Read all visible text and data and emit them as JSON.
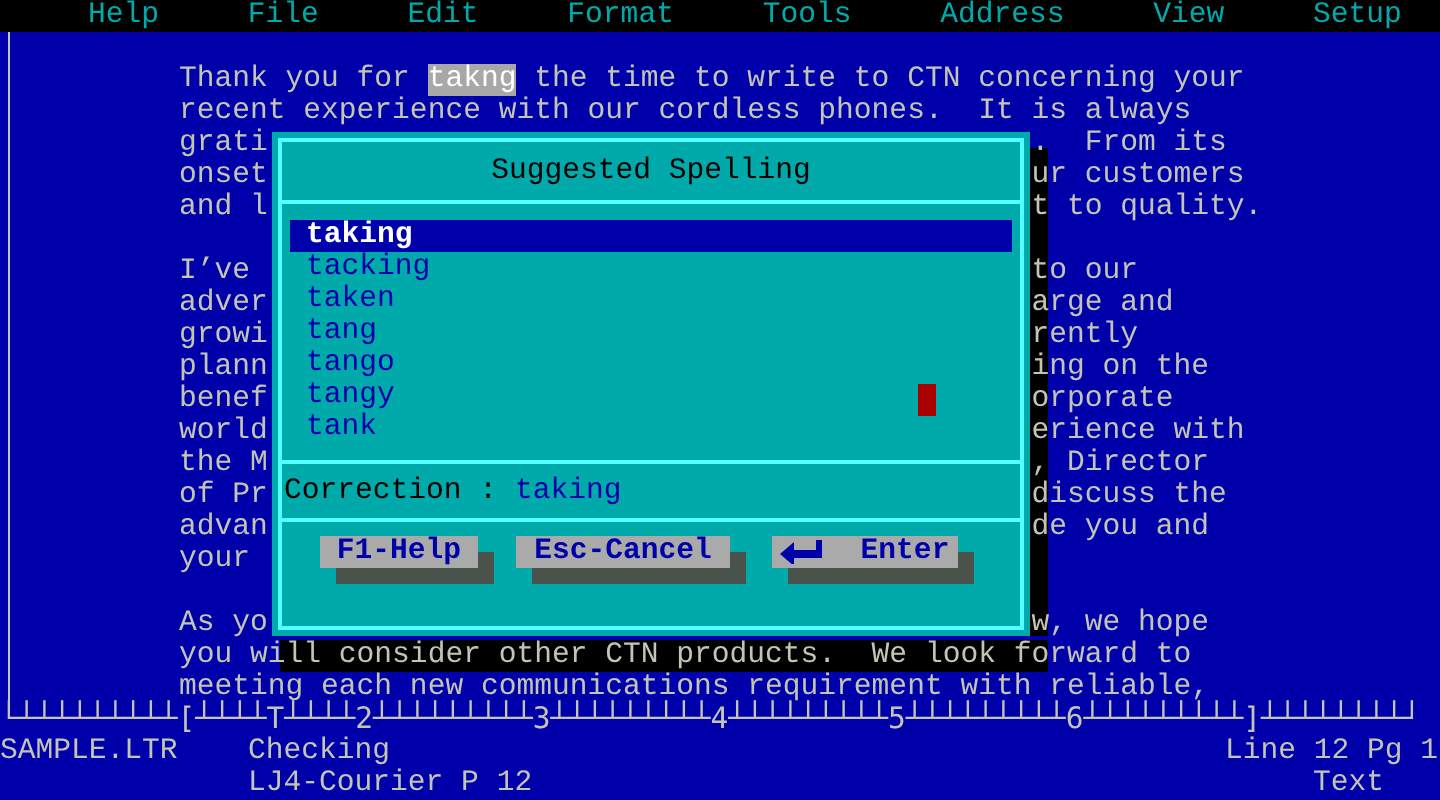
{
  "menu": [
    "Help",
    "File",
    "Edit",
    "Format",
    "Tools",
    "Address",
    "View",
    "Setup"
  ],
  "document": {
    "lines": [
      {
        "kind": "flagged",
        "before": "Thank you for",
        "flagged": "takng",
        "after": "the time to write to CTN concerning your"
      },
      {
        "kind": "full",
        "text": "recent experience with our cordless phones.  It is always"
      },
      {
        "kind": "split",
        "left": "grati",
        "right": ".  From its"
      },
      {
        "kind": "split",
        "left": "onset",
        "right": "ur customers"
      },
      {
        "kind": "split",
        "left": "and l",
        "right": "t to quality."
      },
      {
        "kind": "blank"
      },
      {
        "kind": "split",
        "left": "I’ve",
        "right": "to our"
      },
      {
        "kind": "split",
        "left": "adver",
        "right": "arge and"
      },
      {
        "kind": "split",
        "left": "growi",
        "right": "rently"
      },
      {
        "kind": "split",
        "left": "plann",
        "right": "ing on the"
      },
      {
        "kind": "split",
        "left": "benef",
        "right": "orporate"
      },
      {
        "kind": "split",
        "left": "world",
        "right": "erience with"
      },
      {
        "kind": "split",
        "left": "the M",
        "right": ", Director"
      },
      {
        "kind": "split",
        "left": "of Pr",
        "right": "discuss the"
      },
      {
        "kind": "split",
        "left": "advan",
        "right": "de you and"
      },
      {
        "kind": "split",
        "left": "your"
      },
      {
        "kind": "blank"
      },
      {
        "kind": "split",
        "left": "As yo",
        "right": "w, we hope"
      },
      {
        "kind": "shadowed",
        "text": "you will consider other CTN products.  We look forward to"
      },
      {
        "kind": "full",
        "text": "meeting each new communications requirement with reliable,"
      }
    ]
  },
  "ruler": "└┴┴┴┴┴┴┴┴┴[┴┴┴┴T┴┴┴┴2┴┴┴┴┴┴┴┴┴3┴┴┴┴┴┴┴┴┴4┴┴┴┴┴┴┴┴┴5┴┴┴┴┴┴┴┴┴6┴┴┴┴┴┴┴┴┴]┴┴┴┴┴┴┴┴┘",
  "dialog": {
    "title": "Suggested Spelling",
    "suggestions": [
      {
        "word": "taking",
        "selected": true
      },
      {
        "word": "tacking",
        "selected": false
      },
      {
        "word": "taken",
        "selected": false
      },
      {
        "word": "tang",
        "selected": false
      },
      {
        "word": "tango",
        "selected": false
      },
      {
        "word": "tangy",
        "selected": false
      },
      {
        "word": "tank",
        "selected": false
      }
    ],
    "correction_label": "Correction :",
    "correction": "taking",
    "buttons": [
      {
        "kind": "plain",
        "label": "F1-Help"
      },
      {
        "kind": "plain",
        "label": "Esc-Cancel"
      },
      {
        "kind": "enter",
        "label": "Enter"
      }
    ]
  },
  "status_bar": {
    "file": "SAMPLE.LTR",
    "mode": "Checking",
    "position": "Line 12 Pg 1",
    "font": "LJ4-Courier P 12",
    "view": "Text"
  }
}
